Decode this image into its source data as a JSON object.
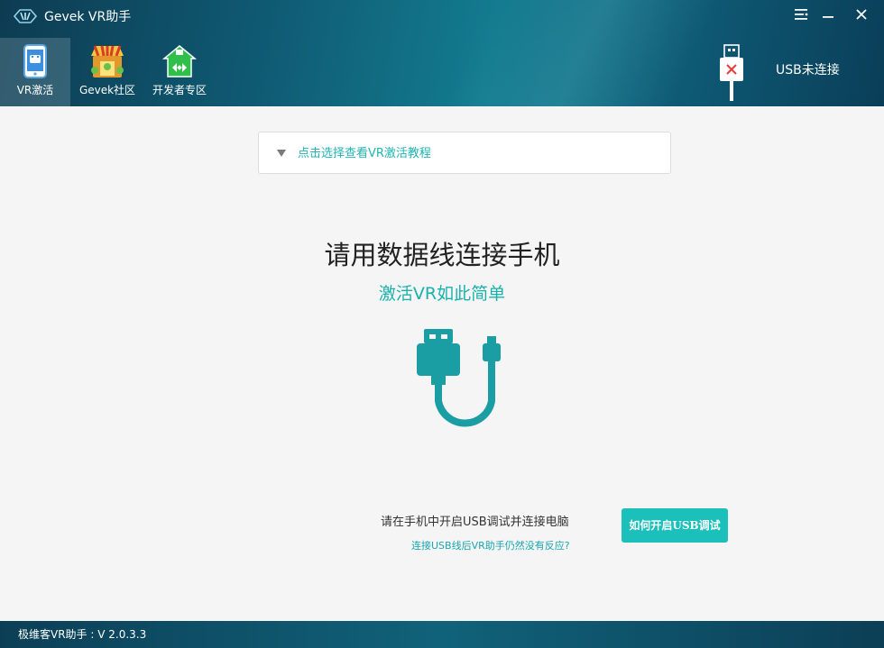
{
  "window": {
    "title": "Gevek VR助手",
    "controls": [
      "menu-icon",
      "minimize-icon",
      "close-icon"
    ]
  },
  "nav": {
    "items": [
      {
        "label": "VR激活",
        "icon": "phone-activate-icon",
        "active": true
      },
      {
        "label": "Gevek社区",
        "icon": "shop-community-icon",
        "active": false
      },
      {
        "label": "开发者专区",
        "icon": "developer-house-icon",
        "active": false
      }
    ]
  },
  "usb": {
    "status_label": "USB未连接",
    "icon": "usb-disconnected-icon"
  },
  "tutorial": {
    "label": "点击选择查看VR激活教程",
    "icon": "triangle-down-icon"
  },
  "main": {
    "headline": "请用数据线连接手机",
    "subline": "激活VR如此简单",
    "illustration": "usb-cable-icon",
    "instruction": "请在手机中开启USB调试并连接电脑",
    "help_button": "如何开启USB调试",
    "help_link": "连接USB线后VR助手仍然没有反应?"
  },
  "footer": {
    "version": "极维客VR助手 : V  2.0.3.3"
  },
  "colors": {
    "accent": "#1cc0bb",
    "header_dark": "#0d3c52",
    "link": "#1aa6b0"
  }
}
